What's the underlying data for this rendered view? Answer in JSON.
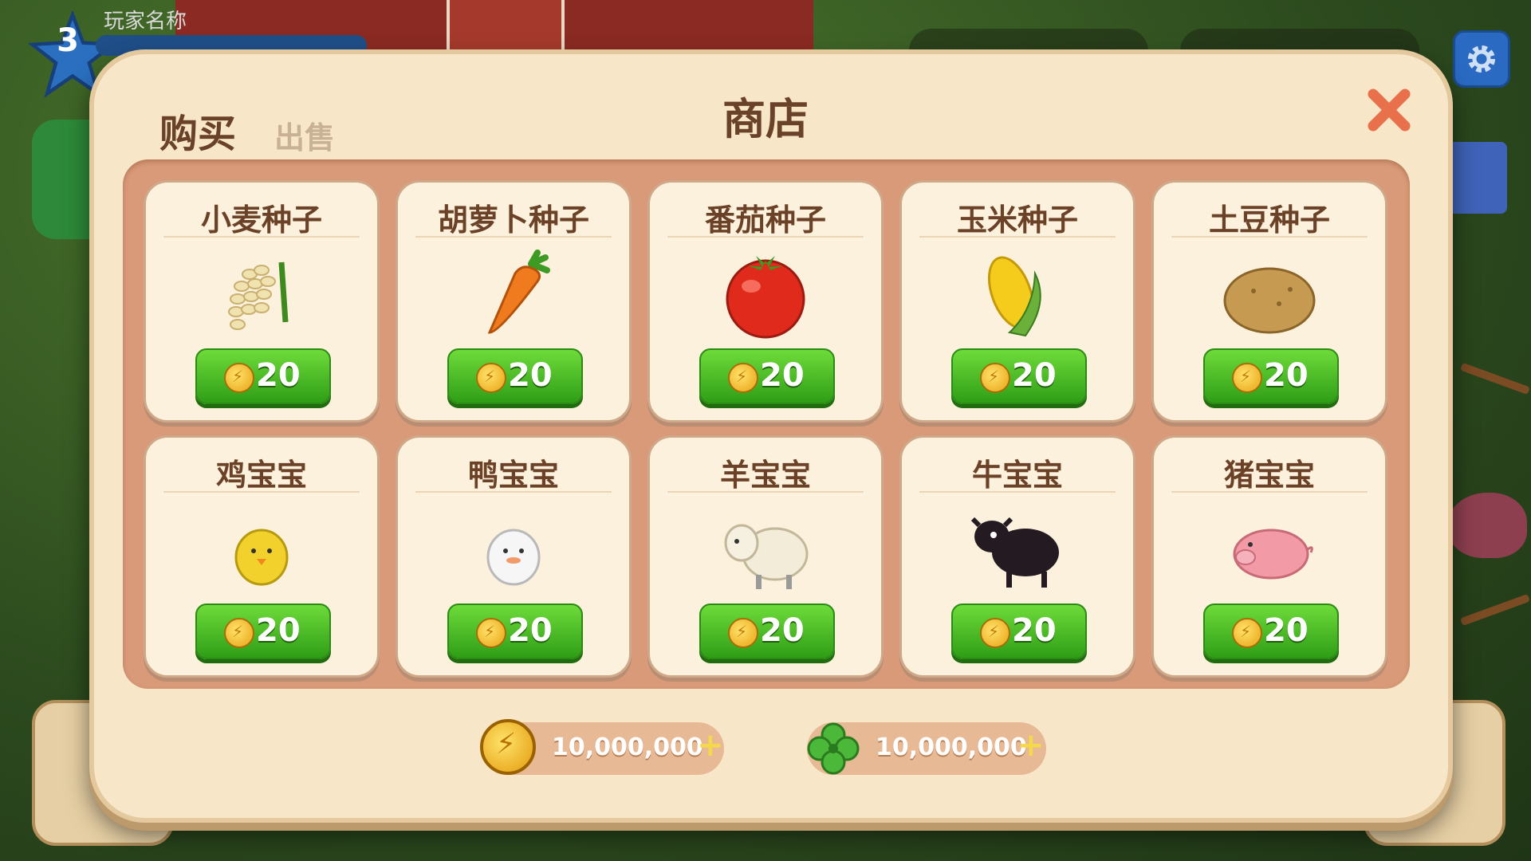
{
  "hud": {
    "level": "3",
    "player_name": "玩家名称"
  },
  "shop": {
    "title": "商店",
    "tabs": {
      "buy": "购买",
      "sell": "出售"
    },
    "items": [
      {
        "name": "小麦种子",
        "price": "20",
        "icon": "wheat-icon"
      },
      {
        "name": "胡萝卜种子",
        "price": "20",
        "icon": "carrot-icon"
      },
      {
        "name": "番茄种子",
        "price": "20",
        "icon": "tomato-icon"
      },
      {
        "name": "玉米种子",
        "price": "20",
        "icon": "corn-icon"
      },
      {
        "name": "土豆种子",
        "price": "20",
        "icon": "potato-icon"
      },
      {
        "name": "鸡宝宝",
        "price": "20",
        "icon": "chick-icon"
      },
      {
        "name": "鸭宝宝",
        "price": "20",
        "icon": "duckling-icon"
      },
      {
        "name": "羊宝宝",
        "price": "20",
        "icon": "lamb-icon"
      },
      {
        "name": "牛宝宝",
        "price": "20",
        "icon": "calf-icon"
      },
      {
        "name": "猪宝宝",
        "price": "20",
        "icon": "piglet-icon"
      }
    ],
    "currencies": {
      "coins": "10,000,000",
      "clovers": "10,000,000",
      "plus": "+"
    }
  },
  "colors": {
    "panel": "#f7e6c7",
    "grid": "#d89a78",
    "button": "#3fbf22",
    "close": "#e8704a",
    "title": "#6a4129"
  }
}
